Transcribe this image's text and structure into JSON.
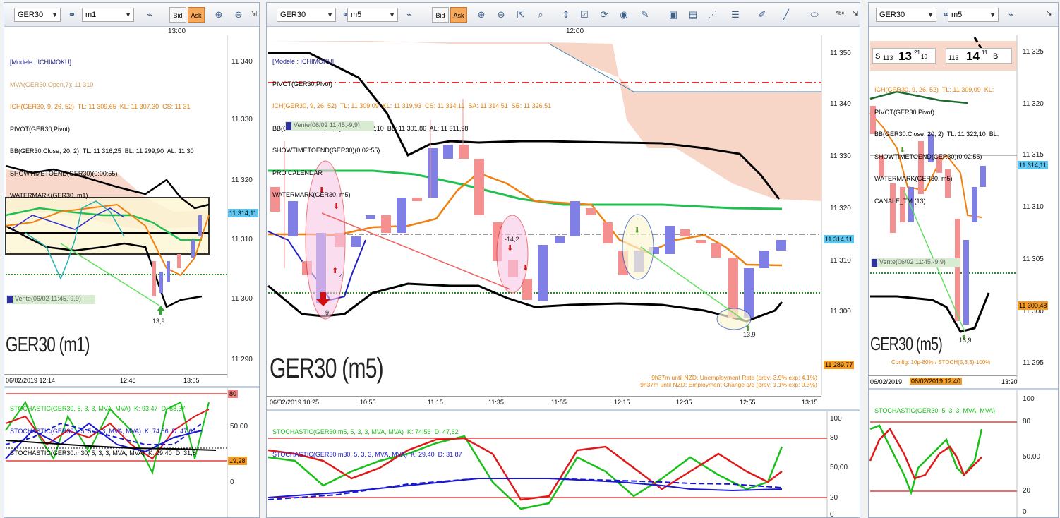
{
  "colors": {
    "accent_orange": "#f6a85c",
    "price_tag_blue": "#59c7f2",
    "price_tag_orange": "#f59b24",
    "bear": "#f49090",
    "bull": "#7f7fe6",
    "cloud": "#f4c8b4",
    "green_kijun": "#20c050"
  },
  "left": {
    "symbol": "GER30",
    "timeframe": "m1",
    "bid": "Bid",
    "ask": "Ask",
    "time_header": "13:00",
    "legend": [
      {
        "text": "[Modele : ICHIMOKU]",
        "color": "#20208c"
      },
      {
        "text": "MVA(GER30.Open,7): 11 310",
        "color": "#c8a060"
      },
      {
        "text": "ICH(GER30, 9, 26, 52)  TL: 11 309,65  KL: 11 307,30  CS: 11 31",
        "color": "#e08010"
      },
      {
        "text": "PIVOT(GER30,Pivot)",
        "color": "#000"
      },
      {
        "text": "BB(GER30.Close, 20, 2)  TL: 11 316,25  BL: 11 299,90  AL: 11 30",
        "color": "#000"
      },
      {
        "text": "SHOWTIMETOEND(GER30)(0:00:55)",
        "color": "#000"
      },
      {
        "text": "WATERMARK(GER30, m1)",
        "color": "#000"
      }
    ],
    "price_axis": [
      "11 340",
      "11 330",
      "11 320",
      "11 310",
      "11 300",
      "11 290"
    ],
    "price_tag": "11 314,11",
    "vente_label": "Vente(06/02 11:45,-9,9)",
    "arrow_label": "13,9",
    "watermark": "GER30 (m1)",
    "time_axis": [
      "06/02/2019 12:14",
      "12:48",
      "13:05"
    ],
    "stoch_legend": [
      {
        "text": "STOCHASTIC(GER30, 5, 3, 3, MVA, MVA)  K: 93,47  D: 88,37",
        "color": "#18c018"
      },
      {
        "text": "STOCHASTIC(GER30.m5, 5, 3, 3, MVA, MVA)  K: 74,56  D: 47,62",
        "color": "#1818d0"
      },
      {
        "text": "STOCHASTIC(GER30.m30, 5, 3, 3, MVA, MVA)  K: 29,40  D: 31,8",
        "color": "#000"
      }
    ],
    "stoch_axis": [
      "80",
      "50,00",
      "19,28",
      "0"
    ]
  },
  "middle": {
    "symbol": "GER30",
    "timeframe": "m5",
    "bid": "Bid",
    "ask": "Ask",
    "time_header": "12:00",
    "legend": [
      {
        "text": "[Modele : ICHIMOKU]",
        "color": "#20208c"
      },
      {
        "text": "PIVOT(GER30,Pivot)",
        "color": "#000"
      },
      {
        "text": "ICH(GER30, 9, 26, 52)  TL: 11 309,09  KL: 11 319,93  CS: 11 314,11  SA: 11 314,51  SB: 11 326,51",
        "color": "#e08010"
      },
      {
        "text": "BB(GER30.Close, 20, 2)  TL: 11 322,10  BL: 11 301,86  AL: 11 311,98",
        "color": "#000"
      },
      {
        "text": "SHOWTIMETOEND(GER30)(0:02:55)",
        "color": "#000"
      },
      {
        "text": "PRO CALENDAR",
        "color": "#000"
      },
      {
        "text": "WATERMARK(GER30, m5)",
        "color": "#000"
      }
    ],
    "price_axis": [
      "11 350",
      "11 340",
      "11 330",
      "11 320",
      "11 310",
      "11 300"
    ],
    "price_tag": "11 314,11",
    "price_tag_low": "11 289,77",
    "vente_label": "Vente(06/02 11:45,-9,9)",
    "annot_14_2": "-14,2",
    "annot_4": "4",
    "annot_9": "9",
    "arrow_label": "13,9",
    "watermark": "GER30 (m5)",
    "news": [
      "9h37m until NZD: Unemployment Rate (prev: 3.9% exp: 4.1%)",
      "9h37m until NZD: Employment Change q/q (prev: 1.1% exp: 0.3%)"
    ],
    "time_axis": [
      "06/02/2019 10:25",
      "10:55",
      "11:15",
      "11:35",
      "11:55",
      "12:15",
      "12:35",
      "12:55",
      "13:15"
    ],
    "stoch_legend": [
      {
        "text": "STOCHASTIC(GER30.m5, 5, 3, 3, MVA, MVA)  K: 74,56  D: 47,62",
        "color": "#18c018"
      },
      {
        "text": "STOCHASTIC(GER30.m30, 5, 3, 3, MVA, MVA)  K: 29,40  D: 31,87",
        "color": "#1818d0"
      }
    ],
    "stoch_axis": [
      "100",
      "80",
      "50,00",
      "20",
      "0"
    ]
  },
  "right": {
    "symbol": "GER30",
    "timeframe": "m5",
    "quote": {
      "s": "S",
      "bid_small": "113",
      "bid_big": "13",
      "bid_sup": "21",
      "bid_sub": "10",
      "ask_small": "113",
      "ask_big": "14",
      "ask_sup": "11",
      "b": "B"
    },
    "legend": [
      {
        "text": "ICH(GER30, 9, 26, 52)  TL: 11 309,09  KL:",
        "color": "#e08010"
      },
      {
        "text": "PIVOT(GER30,Pivot)",
        "color": "#000"
      },
      {
        "text": "BB(GER30.Close, 20, 2)  TL: 11 322,10  BL:",
        "color": "#000"
      },
      {
        "text": "SHOWTIMETOEND(GER30)(0:02:55)",
        "color": "#000"
      },
      {
        "text": "WATERMARK(GER30, m5)",
        "color": "#000"
      },
      {
        "text": "CANALE_TM (13)",
        "color": "#000"
      }
    ],
    "price_axis": [
      "11 325",
      "11 320",
      "11 315",
      "11 310",
      "11 305",
      "11 300",
      "11 295"
    ],
    "price_tag": "11 314,11",
    "price_tag_low": "11 300,48",
    "vente_label": "Vente(06/02 11:45,-9,9)",
    "arrow_label": "13,9",
    "watermark": "GER30 (m5)",
    "config_note": "Config: 10p-80% / STOCH(5,3,3)-100%",
    "time_axis": [
      "06/02/2019",
      "06/02/2019 12:40",
      "13:20"
    ],
    "stoch_legend": [
      {
        "text": "STOCHASTIC(GER30, 5, 3, 3, MVA, MVA)",
        "color": "#18c018"
      }
    ],
    "stoch_axis": [
      "100",
      "80",
      "50,00",
      "20",
      "0"
    ]
  }
}
